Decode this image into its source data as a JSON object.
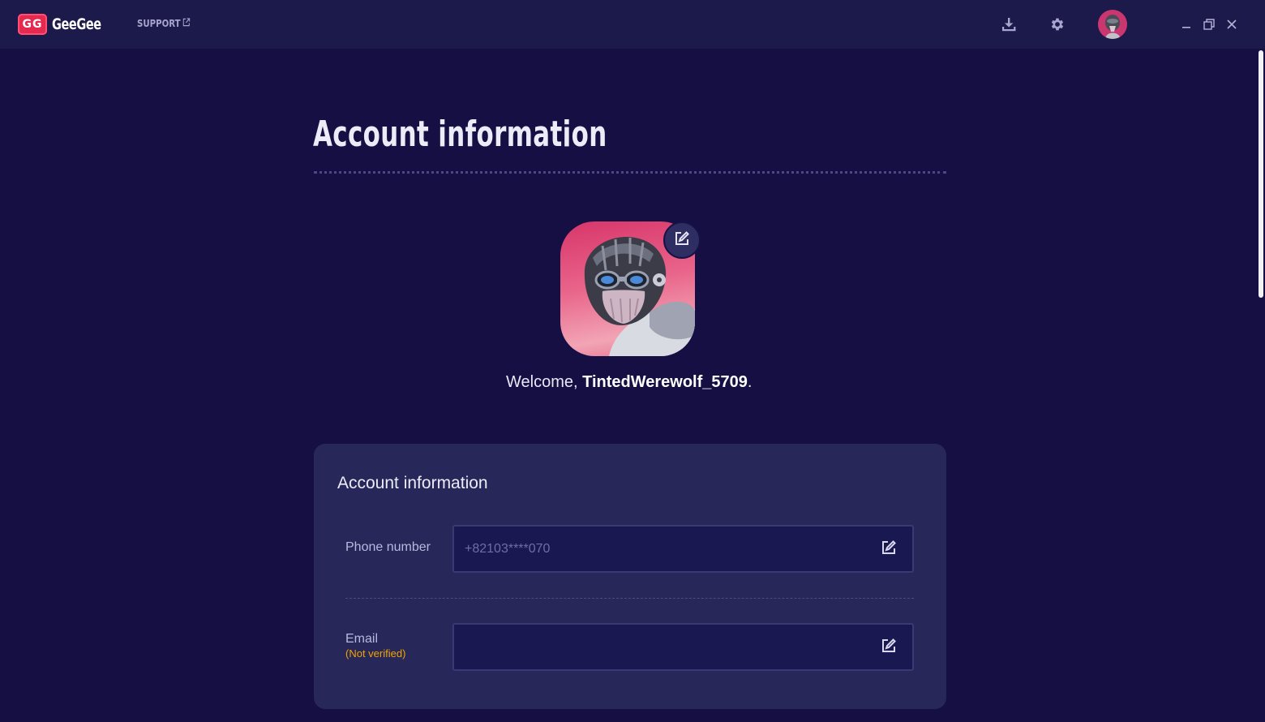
{
  "titlebar": {
    "logo_mark": "GG",
    "logo_text": "GeeGee",
    "support_label": "SUPPORT",
    "icons": {
      "support_external": "external-link-icon",
      "download": "download-icon",
      "settings": "gear-icon",
      "minimize": "minimize-icon",
      "maximize": "restore-icon",
      "close": "close-icon"
    }
  },
  "page": {
    "title": "Account information"
  },
  "profile": {
    "welcome_prefix": "Welcome, ",
    "username": "TintedWerewolf_5709",
    "welcome_suffix": "."
  },
  "card": {
    "title": "Account information",
    "phone": {
      "label": "Phone number",
      "placeholder": "+82103****070",
      "value": ""
    },
    "email": {
      "label": "Email",
      "status": "(Not verified)",
      "value": ""
    }
  },
  "colors": {
    "background": "#150f43",
    "titlebar": "#1b1a4a",
    "card": "#27275a",
    "brand": "#e5294f",
    "warning": "#f0a500"
  }
}
